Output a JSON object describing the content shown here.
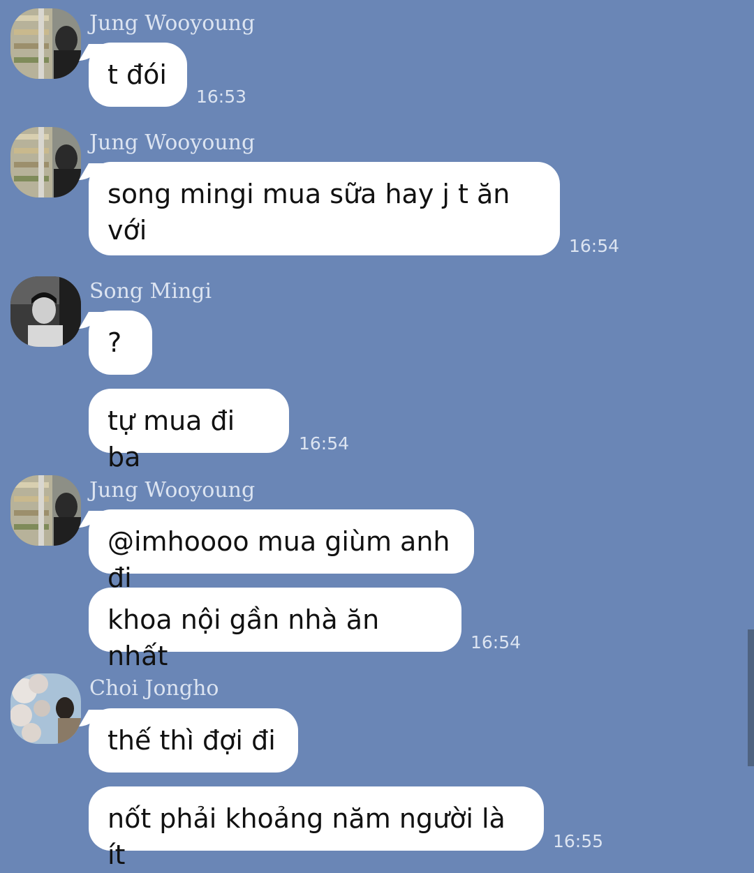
{
  "colors": {
    "background": "#6a86b6",
    "bubble": "#ffffff",
    "meta_text": "#dce4f1",
    "message_text": "#111111"
  },
  "messages": [
    {
      "sender": "Jung Wooyoung",
      "avatar": "avatar-jung-wooyoung",
      "bubbles": [
        "t đói"
      ],
      "time": "16:53"
    },
    {
      "sender": "Jung Wooyoung",
      "avatar": "avatar-jung-wooyoung",
      "bubbles": [
        "song mingi mua sữa hay j t ăn\nvới"
      ],
      "time": "16:54"
    },
    {
      "sender": "Song Mingi",
      "avatar": "avatar-song-mingi",
      "bubbles": [
        "?",
        "tự mua đi ba"
      ],
      "time": "16:54"
    },
    {
      "sender": "Jung Wooyoung",
      "avatar": "avatar-jung-wooyoung",
      "bubbles": [
        "@imhoooo mua giùm anh đi",
        "khoa nội gần nhà ăn nhất"
      ],
      "time": "16:54"
    },
    {
      "sender": "Choi Jongho",
      "avatar": "avatar-choi-jongho",
      "bubbles": [
        "thế thì đợi đi",
        "nốt phải khoảng năm người là ít"
      ],
      "time": "16:55"
    }
  ]
}
